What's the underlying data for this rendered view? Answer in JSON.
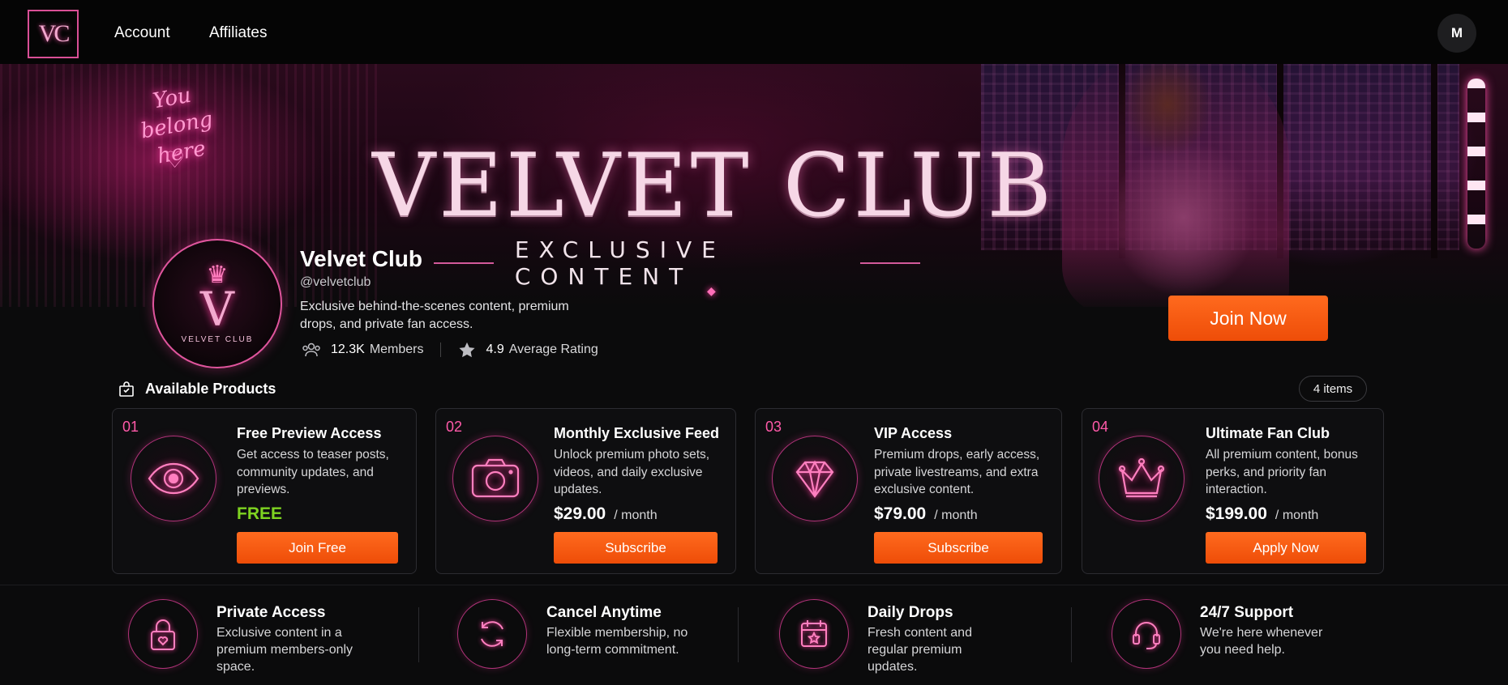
{
  "nav": {
    "logo_text": "VC",
    "links": [
      "Account",
      "Affiliates"
    ],
    "avatar_initial": "M"
  },
  "banner": {
    "neon_text": "You belong here",
    "title": "VELVET CLUB",
    "subtitle": "EXCLUSIVE CONTENT"
  },
  "profile": {
    "logo_text": "VELVET CLUB",
    "logo_letter": "V",
    "name": "Velvet Club",
    "handle": "@velvetclub",
    "description": "Exclusive behind-the-scenes content, premium drops, and private fan access.",
    "members_value": "12.3K",
    "members_label": "Members",
    "rating_value": "4.9",
    "rating_label": "Average Rating",
    "join_label": "Join Now"
  },
  "products": {
    "header": "Available Products",
    "count_label": "4 items",
    "items": [
      {
        "num": "01",
        "icon": "eye-icon",
        "title": "Free Preview Access",
        "description": "Get access to teaser posts, community updates, and previews.",
        "price": "FREE",
        "period": "",
        "button": "Join Free"
      },
      {
        "num": "02",
        "icon": "camera-icon",
        "title": "Monthly Exclusive Feed",
        "description": "Unlock premium photo sets, videos, and daily exclusive updates.",
        "price": "$29.00",
        "period": "/ month",
        "button": "Subscribe"
      },
      {
        "num": "03",
        "icon": "diamond-icon",
        "title": "VIP Access",
        "description": "Premium drops, early access, private livestreams, and extra exclusive content.",
        "price": "$79.00",
        "period": "/ month",
        "button": "Subscribe"
      },
      {
        "num": "04",
        "icon": "crown-icon",
        "title": "Ultimate Fan Club",
        "description": "All premium content, bonus perks, and priority fan interaction.",
        "price": "$199.00",
        "period": "/ month",
        "button": "Apply Now"
      }
    ]
  },
  "features": [
    {
      "icon": "lock-heart-icon",
      "title": "Private Access",
      "description": "Exclusive content in a premium members-only space."
    },
    {
      "icon": "refresh-icon",
      "title": "Cancel Anytime",
      "description": "Flexible membership, no long-term commitment."
    },
    {
      "icon": "calendar-star-icon",
      "title": "Daily Drops",
      "description": "Fresh content and regular premium updates."
    },
    {
      "icon": "headset-icon",
      "title": "24/7 Support",
      "description": "We're here whenever you need help."
    }
  ],
  "colors": {
    "accent_pink": "#ff5aa9",
    "cta_orange": "#f0520c",
    "free_green": "#7ed321",
    "background": "#0b0b0c"
  }
}
